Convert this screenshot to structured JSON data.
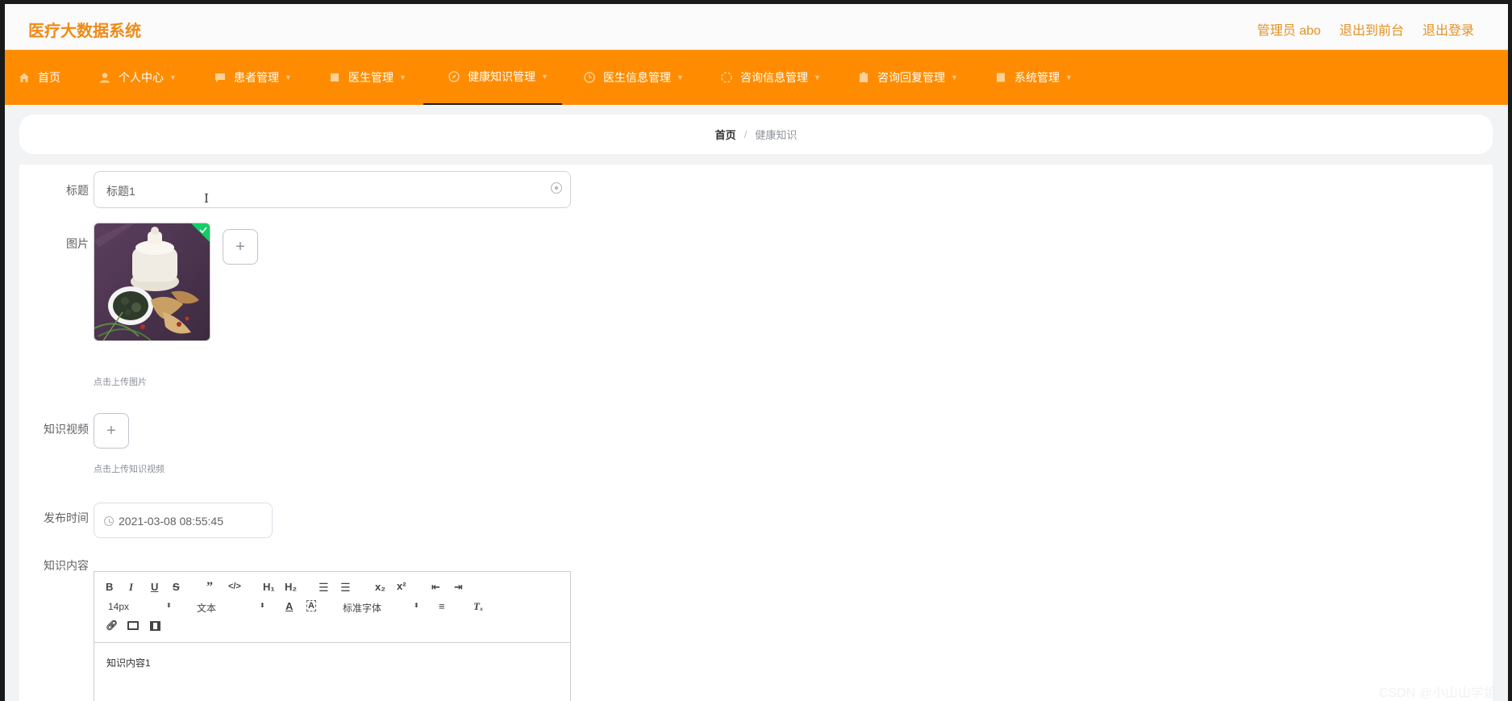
{
  "header": {
    "brand": "医疗大数据系统",
    "admin": "管理员 abo",
    "to_front": "退出到前台",
    "logout": "退出登录"
  },
  "nav": {
    "items": [
      {
        "label": "首页",
        "icon": "home-icon"
      },
      {
        "label": "个人中心",
        "icon": "user-icon"
      },
      {
        "label": "患者管理",
        "icon": "chat-icon"
      },
      {
        "label": "医生管理",
        "icon": "doc-icon"
      },
      {
        "label": "健康知识管理",
        "icon": "compass-icon"
      },
      {
        "label": "医生信息管理",
        "icon": "clock-icon"
      },
      {
        "label": "咨询信息管理",
        "icon": "circle-icon"
      },
      {
        "label": "咨询回复管理",
        "icon": "clipboard-icon"
      },
      {
        "label": "系统管理",
        "icon": "grid-icon"
      }
    ],
    "active_index": 4
  },
  "breadcrumb": {
    "home": "首页",
    "separator": "/",
    "current": "健康知识"
  },
  "form": {
    "title_label": "标题",
    "title_value": "标题1",
    "image_label": "图片",
    "image_hint": "点击上传图片",
    "video_label": "知识视频",
    "video_hint": "点击上传知识视频",
    "date_label": "发布时间",
    "date_value": "2021-03-08 08:55:45",
    "content_label": "知识内容",
    "content_value": "知识内容1"
  },
  "editor": {
    "font_size": "14px",
    "header_select": "文本",
    "font_family": "标准字体"
  },
  "watermark": "CSDN @小山山学姐",
  "colors": {
    "accent": "#ff8c00",
    "brand": "#f08a17",
    "success": "#13ce66"
  }
}
